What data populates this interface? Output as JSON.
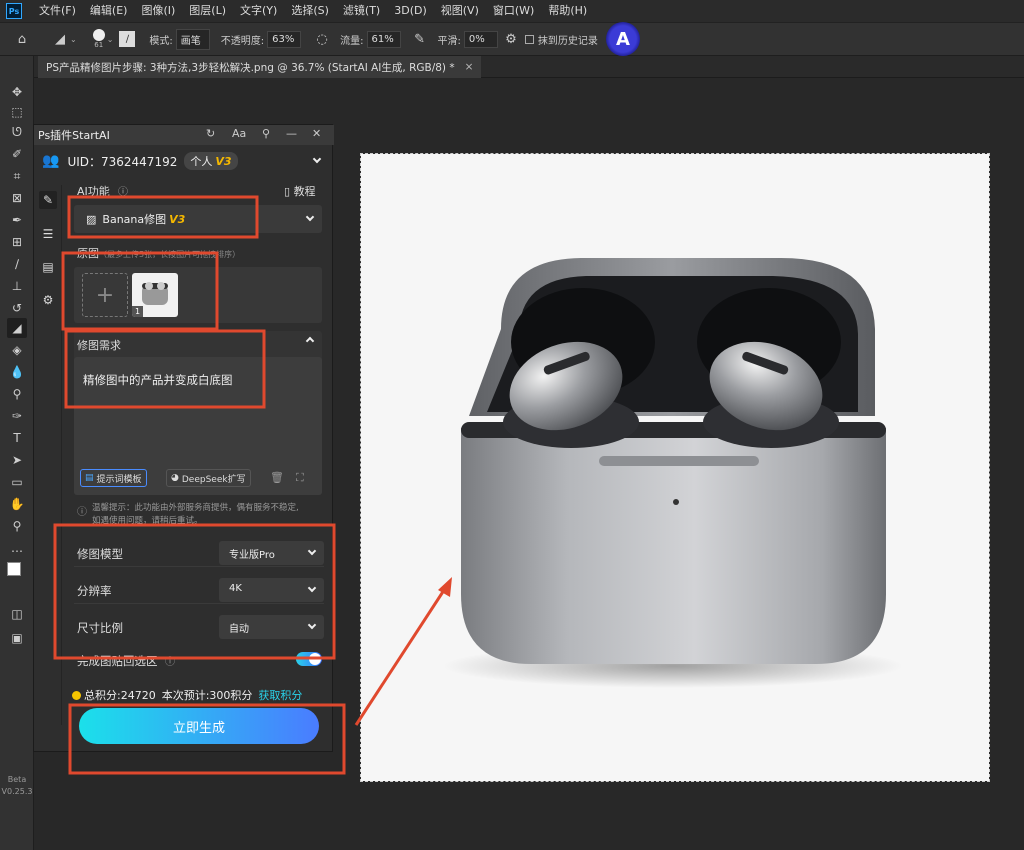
{
  "menubar": {
    "logo": "Ps",
    "items": [
      "文件(F)",
      "编辑(E)",
      "图像(I)",
      "图层(L)",
      "文字(Y)",
      "选择(S)",
      "滤镜(T)",
      "3D(D)",
      "视图(V)",
      "窗口(W)",
      "帮助(H)"
    ]
  },
  "options": {
    "brush_size": "61",
    "mode_label": "模式:",
    "mode_value": "画笔",
    "opacity_label": "不透明度:",
    "opacity_value": "63%",
    "flow_label": "流量:",
    "flow_value": "61%",
    "smooth_label": "平滑:",
    "smooth_value": "0%",
    "history_label": "抹到历史记录"
  },
  "document": {
    "tab_title": "PS产品精修图片步骤: 3种方法,3步轻松解决.png @ 36.7% (StartAI AI生成, RGB/8) *",
    "tab_close": "×"
  },
  "toolbar": {
    "beta_label": "Beta",
    "version": "V0.25.3"
  },
  "panel": {
    "title": "Ps插件StartAI",
    "uid_label": "UID：7362447192",
    "badge_label": "个人",
    "badge_version": "V3",
    "ai_function_label": "AI功能",
    "tutorial_label": "教程",
    "feature_select": "Banana修图",
    "feature_version": "V3",
    "original_label": "原图",
    "original_hint": "（最多上传5张，长按图片可拖拽排序）",
    "thumb_index": "1",
    "prompt_header": "修图需求",
    "prompt_text": "精修图中的产品并变成白底图",
    "prompt_template_btn": "提示词模板",
    "deepseek_btn": "DeepSeek扩写",
    "tip_text_1": "温馨提示：此功能由外部服务商提供，偶有服务不稳定,",
    "tip_text_2": "如遇使用问题，请稍后重试。",
    "rows": [
      {
        "label": "修图模型",
        "value": "专业版Pro"
      },
      {
        "label": "分辨率",
        "value": "4K"
      },
      {
        "label": "尺寸比例",
        "value": "自动"
      }
    ],
    "auto_select_label": "完成图贴回选区",
    "points_total": "总积分:24720",
    "points_cost": "本次预计:300积分",
    "points_get": "获取积分",
    "generate_button": "立即生成"
  },
  "colors": {
    "annotation": "#e0492e",
    "accent_gradient_start": "#1be0ea",
    "accent_gradient_end": "#4a7cff",
    "version_badge": "#f5b800"
  }
}
